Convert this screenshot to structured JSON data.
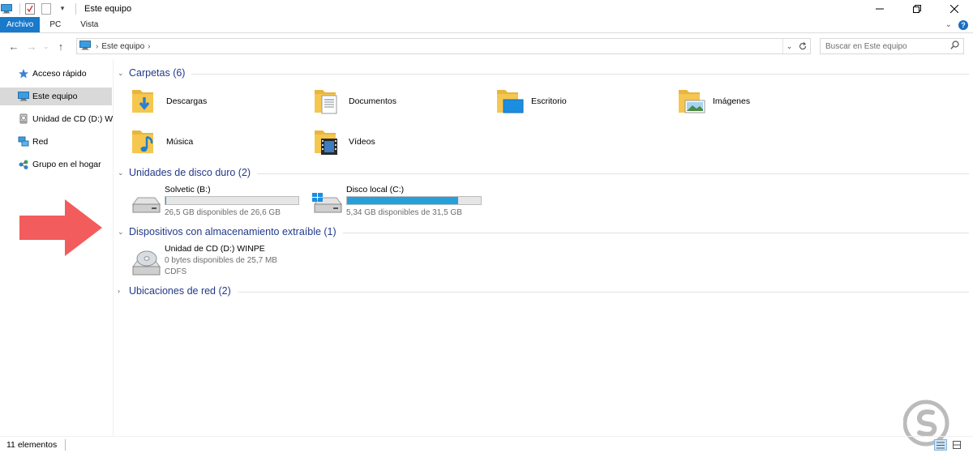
{
  "window": {
    "title": "Este equipo",
    "icons": [
      "computer-icon",
      "properties-icon",
      "new-folder-icon",
      "customize-dropdown-icon"
    ]
  },
  "ribbon": {
    "tabs": [
      {
        "label": "Archivo",
        "active": true
      },
      {
        "label": "PC"
      },
      {
        "label": "Vista"
      }
    ]
  },
  "address": {
    "crumbs": [
      "Este equipo"
    ],
    "search_placeholder": "Buscar en Este equipo"
  },
  "sidebar": {
    "items": [
      {
        "label": "Acceso rápido",
        "icon": "star-icon"
      },
      {
        "label": "Este equipo",
        "icon": "computer-icon",
        "selected": true
      },
      {
        "label": "Unidad de CD (D:) WI",
        "icon": "cd-drive-icon"
      },
      {
        "label": "Red",
        "icon": "network-icon"
      },
      {
        "label": "Grupo en el hogar",
        "icon": "homegroup-icon"
      }
    ]
  },
  "groups": {
    "folders": {
      "title": "Carpetas (6)"
    },
    "drives": {
      "title": "Unidades de disco duro (2)"
    },
    "removable": {
      "title": "Dispositivos con almacenamiento extraíble (1)"
    },
    "network": {
      "title": "Ubicaciones de red (2)"
    }
  },
  "folders": [
    {
      "label": "Descargas",
      "icon": "downloads-folder-icon"
    },
    {
      "label": "Documentos",
      "icon": "documents-folder-icon"
    },
    {
      "label": "Escritorio",
      "icon": "desktop-folder-icon"
    },
    {
      "label": "Imágenes",
      "icon": "pictures-folder-icon"
    },
    {
      "label": "Música",
      "icon": "music-folder-icon"
    },
    {
      "label": "Vídeos",
      "icon": "videos-folder-icon"
    }
  ],
  "drives": [
    {
      "name": "Solvetic (B:)",
      "free": "26,5 GB disponibles de 26,6 GB",
      "used_fraction": 0.004
    },
    {
      "name": "Disco local (C:)",
      "free": "5,34 GB disponibles de 31,5 GB",
      "used_fraction": 0.83
    }
  ],
  "removable": [
    {
      "name": "Unidad de CD (D:) WINPE",
      "free": "0 bytes disponibles de 25,7 MB",
      "fs": "CDFS"
    }
  ],
  "status": {
    "count": "11 elementos"
  },
  "colors": {
    "accent": "#1979ca",
    "drive_bar": "#26a0da",
    "group_title": "#1e395b",
    "arrow": "#f25c5c",
    "folder": "#f5c74f"
  }
}
